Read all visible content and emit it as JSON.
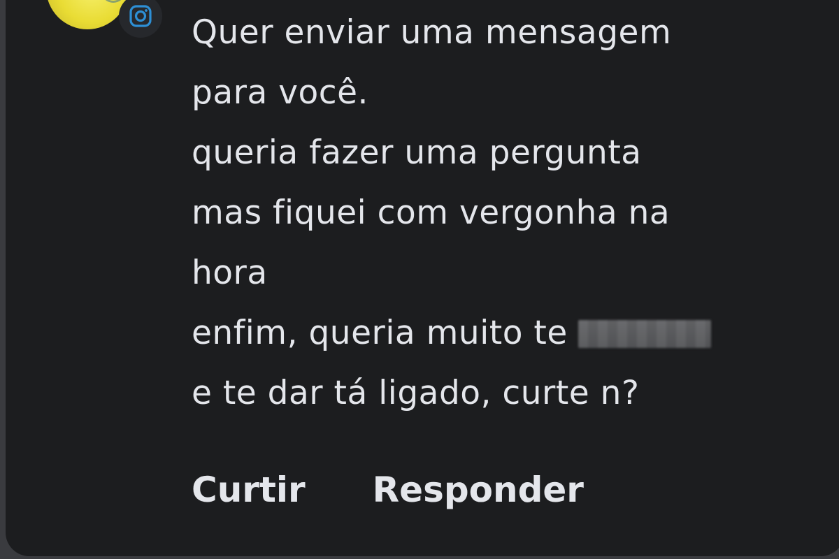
{
  "comment": {
    "lines": [
      "Quer enviar uma mensagem",
      "para você.",
      "queria fazer uma pergunta",
      "mas fiquei com vergonha na",
      "hora",
      "enfim, queria muito te ",
      "e te dar tá ligado, curte n?"
    ],
    "redacted_word_icon": "blurred-redaction",
    "source_badge_icon": "instagram-icon"
  },
  "actions": {
    "like_label": "Curtir",
    "reply_label": "Responder"
  },
  "colors": {
    "card_background": "#1c1d1f",
    "text": "#e4e6eb",
    "instagram_badge": "#2d8fd5"
  }
}
